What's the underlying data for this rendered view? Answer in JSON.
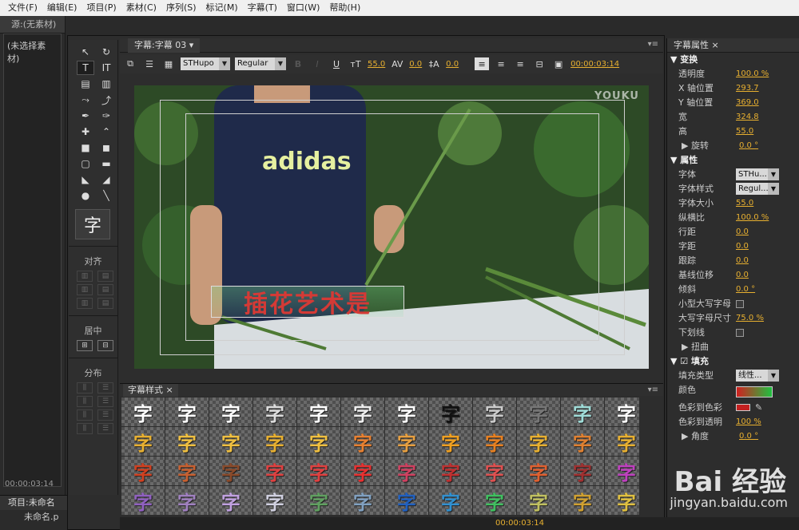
{
  "menu": [
    "文件(F)",
    "编辑(E)",
    "项目(P)",
    "素材(C)",
    "序列(S)",
    "标记(M)",
    "字幕(T)",
    "窗口(W)",
    "帮助(H)"
  ],
  "source": {
    "tab": "源:(无素材)",
    "body": "(未选择素材)",
    "timecode": "00:00:03:14"
  },
  "project": {
    "tab": "项目:未命名",
    "item": "未命名.p"
  },
  "title_tab": "字幕:字幕 03",
  "toolbar": {
    "font": "STHupo",
    "style": "Regular",
    "size": "55.0",
    "kerning": "0.0",
    "leading": "0.0",
    "timecode": "00:00:03:14"
  },
  "canvas": {
    "title_text": "插花艺术是",
    "shirt_logo": "adidas",
    "watermark": "YOUKU"
  },
  "tools": {
    "preview": "字",
    "align_label": "对齐",
    "center_label": "居中",
    "distribute_label": "分布"
  },
  "styles_tab": "字幕样式",
  "style_cells": [
    {
      "t": "字",
      "c": "#ffffff"
    },
    {
      "t": "字",
      "c": "#ffffff"
    },
    {
      "t": "字",
      "c": "#ffffff"
    },
    {
      "t": "字",
      "c": "#dddddd"
    },
    {
      "t": "字",
      "c": "#ffffff"
    },
    {
      "t": "字",
      "c": "#eeeeee"
    },
    {
      "t": "字",
      "c": "#ffffff"
    },
    {
      "t": "字",
      "c": "#111111"
    },
    {
      "t": "字",
      "c": "#cccccc"
    },
    {
      "t": "字",
      "c": "#777777"
    },
    {
      "t": "字",
      "c": "#9fdcd8"
    },
    {
      "t": "字",
      "c": "#ffffff"
    },
    {
      "t": "字",
      "c": "#e8b030"
    },
    {
      "t": "字",
      "c": "#f0c040"
    },
    {
      "t": "字",
      "c": "#f0c040"
    },
    {
      "t": "字",
      "c": "#e8b030"
    },
    {
      "t": "字",
      "c": "#f0c040"
    },
    {
      "t": "字",
      "c": "#e88030"
    },
    {
      "t": "字",
      "c": "#e8a040"
    },
    {
      "t": "字",
      "c": "#f0a020"
    },
    {
      "t": "字",
      "c": "#e88020"
    },
    {
      "t": "字",
      "c": "#e8b030"
    },
    {
      "t": "字",
      "c": "#e08030"
    },
    {
      "t": "字",
      "c": "#e8b030"
    },
    {
      "t": "字",
      "c": "#d04020"
    },
    {
      "t": "字",
      "c": "#c86030"
    },
    {
      "t": "字",
      "c": "#8a4a2a"
    },
    {
      "t": "字",
      "c": "#e04040"
    },
    {
      "t": "字",
      "c": "#e04040"
    },
    {
      "t": "字",
      "c": "#e83030"
    },
    {
      "t": "字",
      "c": "#d04060"
    },
    {
      "t": "字",
      "c": "#c03030"
    },
    {
      "t": "字",
      "c": "#e05050"
    },
    {
      "t": "字",
      "c": "#e06030"
    },
    {
      "t": "字",
      "c": "#a03030"
    },
    {
      "t": "字",
      "c": "#c040c0"
    },
    {
      "t": "字",
      "c": "#9060c0"
    },
    {
      "t": "字",
      "c": "#a080c0"
    },
    {
      "t": "字",
      "c": "#c0a0e0"
    },
    {
      "t": "字",
      "c": "#d0d0e0"
    },
    {
      "t": "字",
      "c": "#60a060"
    },
    {
      "t": "字",
      "c": "#80a0c0"
    },
    {
      "t": "字",
      "c": "#2060c0"
    },
    {
      "t": "字",
      "c": "#3090d0"
    },
    {
      "t": "字",
      "c": "#40c060"
    },
    {
      "t": "字",
      "c": "#c0c060"
    },
    {
      "t": "字",
      "c": "#d0a030"
    },
    {
      "t": "字",
      "c": "#e0c040"
    }
  ],
  "props": {
    "tab": "字幕属性",
    "transform": {
      "head": "变换",
      "rows": [
        {
          "label": "透明度",
          "value": "100.0 %"
        },
        {
          "label": "X 轴位置",
          "value": "293.7"
        },
        {
          "label": "Y 轴位置",
          "value": "369.0"
        },
        {
          "label": "宽",
          "value": "324.8"
        },
        {
          "label": "高",
          "value": "55.0"
        }
      ],
      "rotation": {
        "label": "旋转",
        "value": "0.0 °"
      }
    },
    "attrs": {
      "head": "属性",
      "font": {
        "label": "字体",
        "value": "STHu..."
      },
      "style": {
        "label": "字体样式",
        "value": "Regul..."
      },
      "rows": [
        {
          "label": "字体大小",
          "value": "55.0"
        },
        {
          "label": "纵横比",
          "value": "100.0 %"
        },
        {
          "label": "行距",
          "value": "0.0"
        },
        {
          "label": "字距",
          "value": "0.0"
        },
        {
          "label": "跟踪",
          "value": "0.0"
        },
        {
          "label": "基线位移",
          "value": "0.0"
        },
        {
          "label": "倾斜",
          "value": "0.0 °"
        }
      ],
      "smallcaps": "小型大写字母",
      "smallcaps_size": {
        "label": "大写字母尺寸",
        "value": "75.0 %"
      },
      "underline": "下划线",
      "distort": "扭曲"
    },
    "fill": {
      "head": "填充",
      "type": {
        "label": "填充类型",
        "value": "线性..."
      },
      "color_label": "颜色",
      "color_to_color": "色彩到色彩",
      "color_to_opacity": {
        "label": "色彩到透明",
        "value": "100 %"
      },
      "angle": {
        "label": "角度",
        "value": "0.0 °"
      }
    }
  },
  "watermark": {
    "brand": "Bai 经验",
    "url": "jingyan.baidu.com"
  },
  "bottom": {
    "timecode": "00:00:03:14"
  }
}
